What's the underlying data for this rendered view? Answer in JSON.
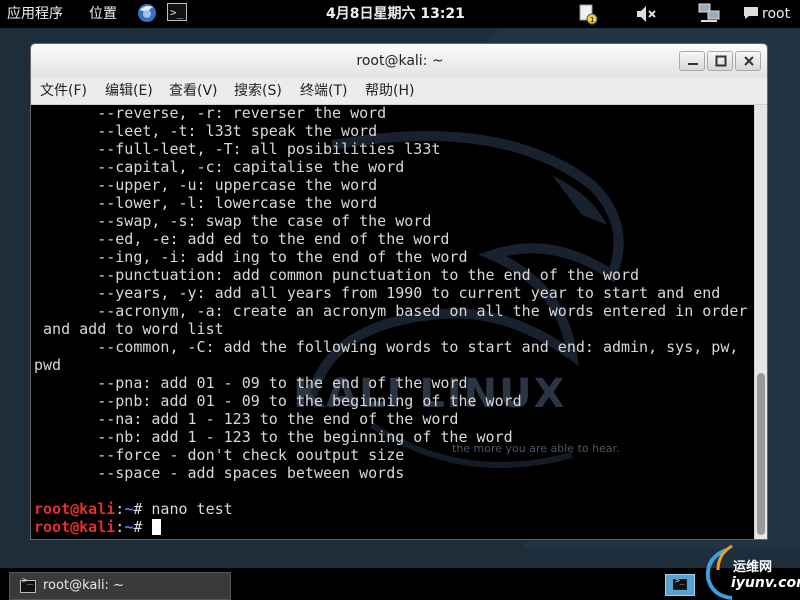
{
  "top_panel": {
    "applications": "应用程序",
    "places": "位置",
    "terminal_icon_glyph": ">_",
    "clock": "4月8日星期六 13:21",
    "user": "root"
  },
  "window": {
    "title": "root@kali: ~",
    "menu": [
      "文件(F)",
      "编辑(E)",
      "查看(V)",
      "搜索(S)",
      "终端(T)",
      "帮助(H)"
    ]
  },
  "terminal": {
    "output_lines": [
      "       --reverse, -r: reverser the word",
      "       --leet, -t: l33t speak the word",
      "       --full-leet, -T: all posibilities l33t",
      "       --capital, -c: capitalise the word",
      "       --upper, -u: uppercase the word",
      "       --lower, -l: lowercase the word",
      "       --swap, -s: swap the case of the word",
      "       --ed, -e: add ed to the end of the word",
      "       --ing, -i: add ing to the end of the word",
      "       --punctuation: add common punctuation to the end of the word",
      "       --years, -y: add all years from 1990 to current year to start and end",
      "       --acronym, -a: create an acronym based on all the words entered in order",
      " and add to word list",
      "       --common, -C: add the following words to start and end: admin, sys, pw,",
      "pwd",
      "       --pna: add 01 - 09 to the end of the word",
      "       --pnb: add 01 - 09 to the beginning of the word",
      "       --na: add 1 - 123 to the end of the word",
      "       --nb: add 1 - 123 to the beginning of the word",
      "       --force - don't check ooutput size",
      "       --space - add spaces between words",
      ""
    ],
    "prompt_user": "root@kali",
    "prompt_sep": ":",
    "prompt_path": "~",
    "prompt_sym": "# ",
    "last_command": "nano test",
    "watermark": "KALI LINUX",
    "watermark_sub": "the more you are able to hear."
  },
  "bottom_panel": {
    "task_label": "root@kali: ~",
    "terminal_icon_glyph": ">_"
  },
  "logo": {
    "cn": "运维网",
    "en": "iyunv.com"
  },
  "colors": {
    "prompt_user": "#e03030",
    "prompt_path": "#5080ff",
    "terminal_text": "#d8d8d8",
    "terminal_bg": "#000000"
  }
}
